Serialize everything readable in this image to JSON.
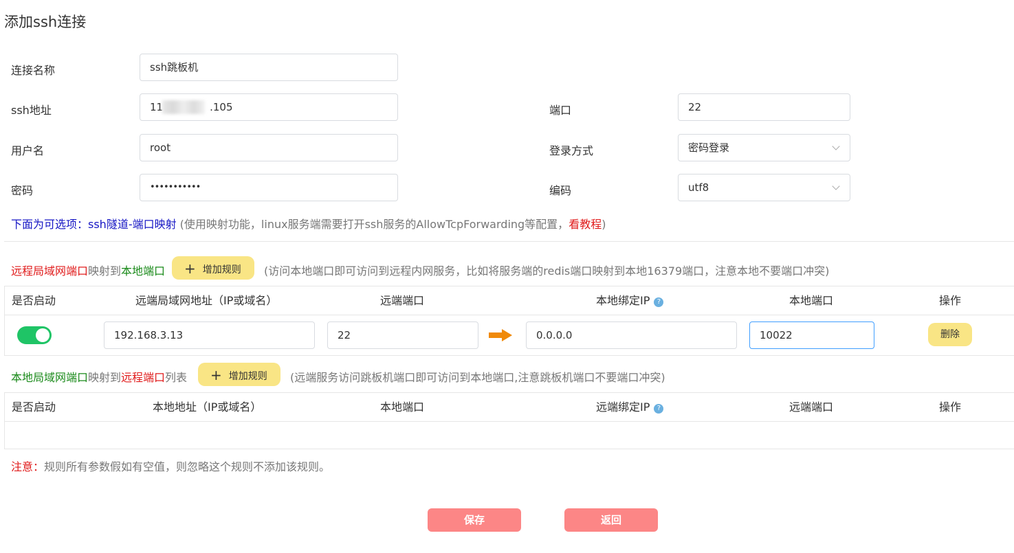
{
  "page_title": "添加ssh连接",
  "form": {
    "conn_name_label": "连接名称",
    "conn_name_value": "ssh跳板机",
    "ssh_addr_label": "ssh地址",
    "ssh_addr_prefix": "11",
    "ssh_addr_suffix": ".105",
    "port_label": "端口",
    "port_value": "22",
    "user_label": "用户名",
    "user_value": "root",
    "login_label": "登录方式",
    "login_value": "密码登录",
    "pwd_label": "密码",
    "pwd_value": "•••••••••••",
    "enc_label": "编码",
    "enc_value": "utf8"
  },
  "optional_hint": {
    "prefix": "下面为可选项：ssh隧道-端口映射",
    "middle": " (使用映射功能，linux服务端需要打开ssh服务的AllowTcpForwarding等配置，",
    "link": "看教程",
    "suffix": ")"
  },
  "remote_section": {
    "part1": "远程局域网端口",
    "part2": "映射到",
    "part3": "本地端口",
    "add_label": "增加规则",
    "desc": "(访问本地端口即可访问到远程内网服务，比如将服务端的redis端口映射到本地16379端口，注意本地不要端口冲突)",
    "columns": [
      "是否启动",
      "远端局域网地址（IP或域名）",
      "远端端口",
      "本地绑定IP",
      "本地端口",
      "操作"
    ],
    "row": {
      "enabled": true,
      "remote_addr": "192.168.3.13",
      "remote_port": "22",
      "local_ip": "0.0.0.0",
      "local_port": "10022",
      "delete_label": "删除"
    }
  },
  "local_section": {
    "part1": "本地局域网端口",
    "part2": "映射到",
    "part3": "远程端口",
    "part4": "列表",
    "add_label": "增加规则",
    "desc": "(远端服务访问跳板机端口即可访问到本地端口,注意跳板机端口不要端口冲突)",
    "columns": [
      "是否启动",
      "本地地址（IP或域名）",
      "本地端口",
      "远端绑定IP",
      "远端端口",
      "操作"
    ]
  },
  "note": {
    "label": "注意：",
    "text": "规则所有参数假如有空值，则忽略这个规则不添加该规则。"
  },
  "buttons": {
    "save": "保存",
    "back": "返回"
  },
  "colors": {
    "toggle_on": "#1fc466",
    "add_button": "#f9e585",
    "primary_button": "#fc8686",
    "arrow": "#f08a0a",
    "focus_border": "#409eff"
  }
}
